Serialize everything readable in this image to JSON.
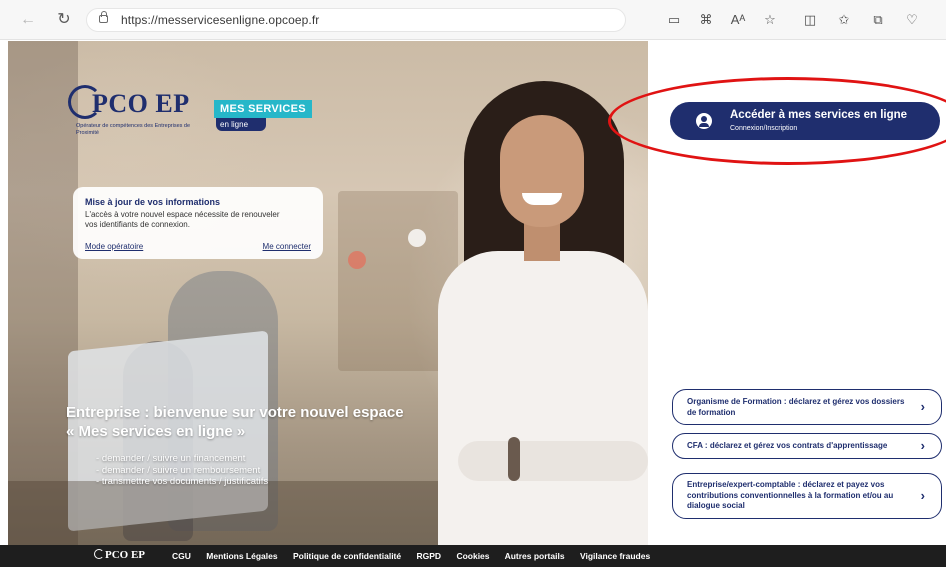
{
  "browser": {
    "url": "https://messervicesenligne.opcoep.fr",
    "icons": [
      "back-icon",
      "reload-icon",
      "lock-icon",
      "read-aloud-icon",
      "apps-icon",
      "text-size-icon",
      "favorite-star-icon",
      "split-screen-icon",
      "favorites-icon",
      "collections-icon",
      "extensions-icon"
    ]
  },
  "hero": {
    "logo_main": "PCO EP",
    "logo_tagline": "Opérateur de compétences des Entreprises de Proximité",
    "badge_top": "MES SERVICES",
    "badge_bottom": "en ligne",
    "info_card": {
      "title": "Mise à jour de vos informations",
      "text": "L'accès à votre nouvel espace nécessite de renouveler vos identifiants de connexion.",
      "link_left": "Mode opératoire",
      "link_right": "Me connecter"
    },
    "title_line1": "Entreprise : bienvenue sur votre nouvel espace",
    "title_line2": "« Mes services en ligne »",
    "list": [
      "demander / suivre un financement",
      "demander / suivre un remboursement",
      "transmettre vos documents / justificatifs"
    ]
  },
  "panel": {
    "cta_label": "Accéder à mes services en ligne",
    "cta_sub": "Connexion/Inscription",
    "cards": [
      {
        "text": "Organisme de Formation : déclarez et gérez vos dossiers de formation",
        "chevron": "›"
      },
      {
        "text": "CFA : déclarez et gérez vos contrats d'apprentissage",
        "chevron": "›"
      },
      {
        "text": "Entreprise/expert-comptable : déclarez et payez vos contributions conventionnelles à la formation et/ou au dialogue social",
        "chevron": "›"
      }
    ],
    "highlight_color": "#e01313",
    "brand_color": "#1f2e6e"
  },
  "footer": {
    "logo": "PCO EP",
    "links": [
      "CGU",
      "Mentions Légales",
      "Politique de confidentialité",
      "RGPD",
      "Cookies",
      "Autres portails",
      "Vigilance fraudes"
    ]
  }
}
